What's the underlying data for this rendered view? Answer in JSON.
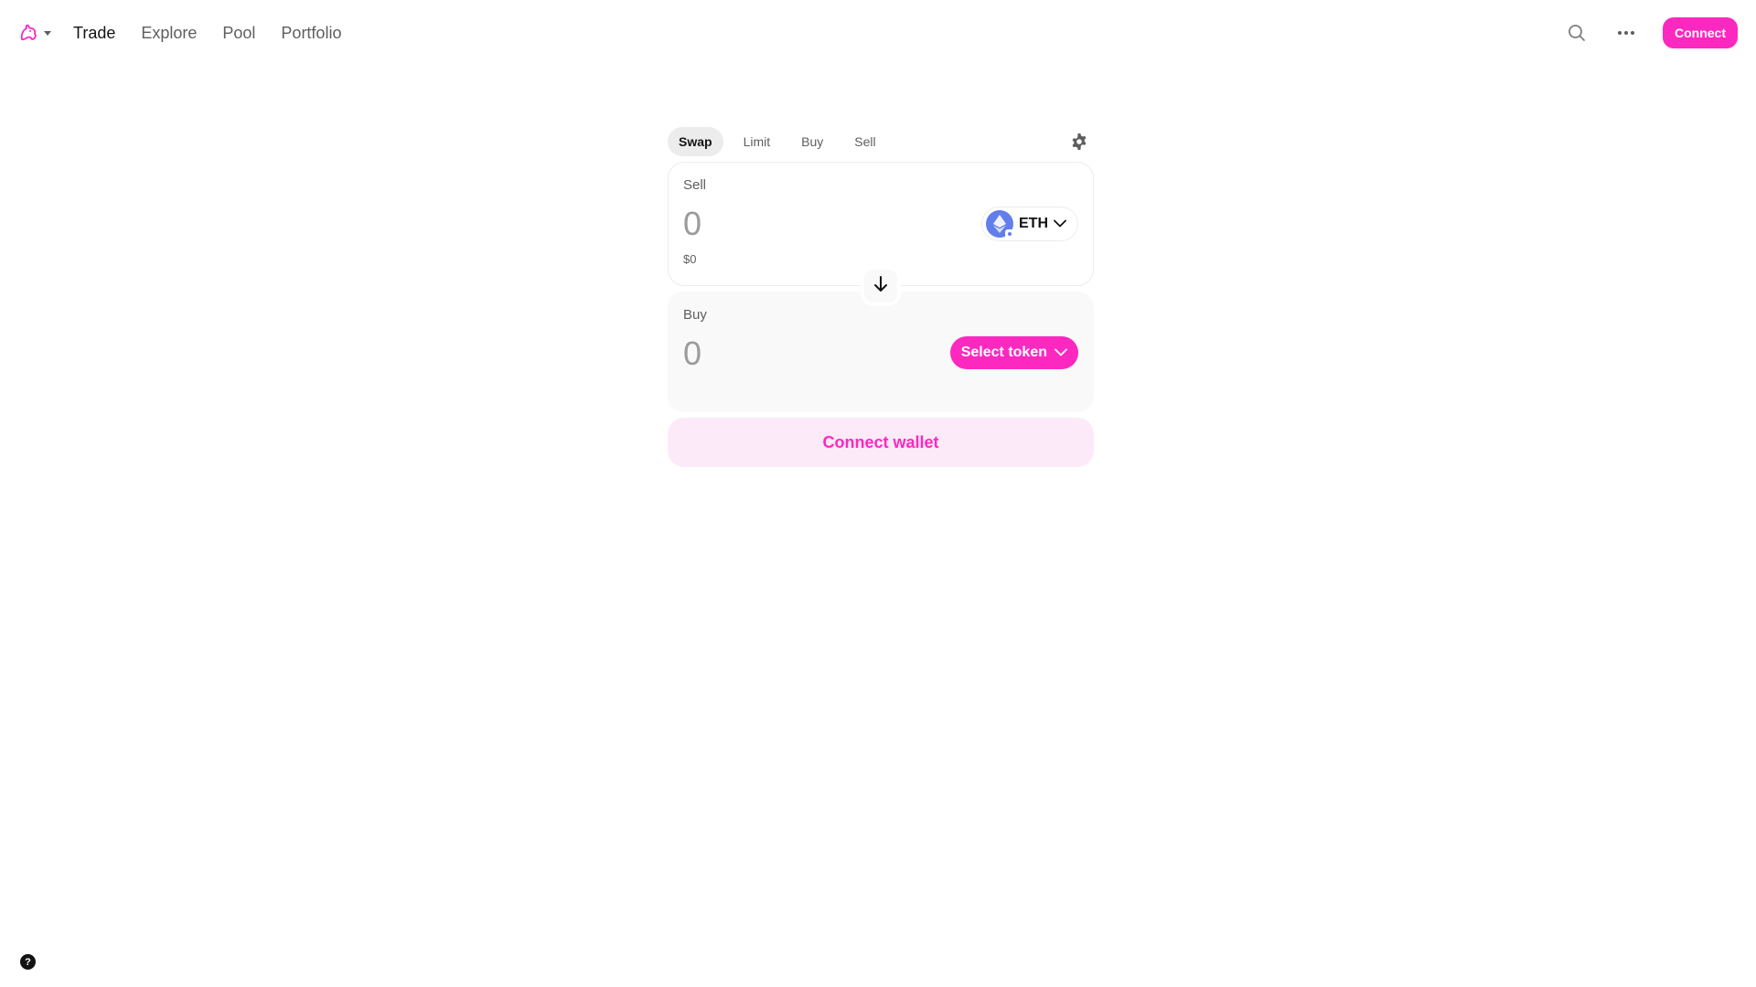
{
  "nav": {
    "logo_icon": "uniswap-unicorn-icon",
    "logo_dropdown_icon": "caret-down-icon",
    "links": [
      {
        "label": "Trade",
        "active": true
      },
      {
        "label": "Explore",
        "active": false
      },
      {
        "label": "Pool",
        "active": false
      },
      {
        "label": "Portfolio",
        "active": false
      }
    ],
    "search_icon": "search-icon",
    "more_icon": "more-horizontal-icon",
    "connect_label": "Connect"
  },
  "swap": {
    "tabs": [
      {
        "label": "Swap",
        "active": true
      },
      {
        "label": "Limit",
        "active": false
      },
      {
        "label": "Buy",
        "active": false
      },
      {
        "label": "Sell",
        "active": false
      }
    ],
    "settings_icon": "gear-icon",
    "sell": {
      "label": "Sell",
      "amount": "0",
      "usd_value": "$0",
      "token": {
        "symbol": "ETH",
        "icon": "eth-token-icon"
      }
    },
    "switch_icon": "arrow-down-icon",
    "buy": {
      "label": "Buy",
      "amount": "0",
      "select_token_label": "Select token"
    },
    "connect_wallet_label": "Connect wallet"
  },
  "help": {
    "label": "?"
  },
  "colors": {
    "accent": "#fc28c0",
    "accent_soft": "#fdeaf8",
    "eth": "#627eea",
    "muted_text": "#5e5e5e",
    "placeholder": "#9b9b9b"
  }
}
